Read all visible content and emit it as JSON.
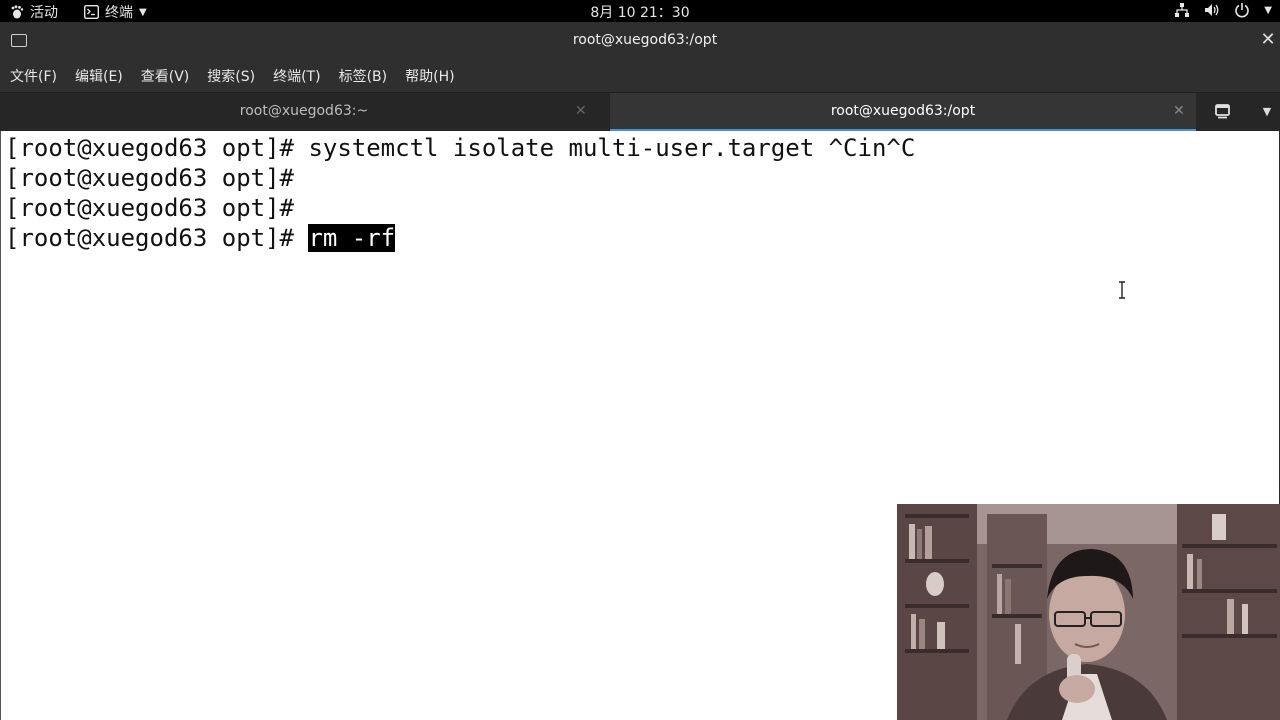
{
  "topbar": {
    "activities_label": "活动",
    "app_label": "终端",
    "clock": "8月 10  21：30"
  },
  "window": {
    "title": "root@xuegod63:/opt"
  },
  "menu": {
    "items": [
      "文件(F)",
      "编辑(E)",
      "查看(V)",
      "搜索(S)",
      "终端(T)",
      "标签(B)",
      "帮助(H)"
    ]
  },
  "tabs": [
    {
      "label": "root@xuegod63:~",
      "active": false
    },
    {
      "label": "root@xuegod63:/opt",
      "active": true
    }
  ],
  "terminal": {
    "lines": [
      {
        "prompt": "[root@xuegod63 opt]# ",
        "command": "systemctl isolate multi-user.target ^Cin^C",
        "selected": ""
      },
      {
        "prompt": "[root@xuegod63 opt]# ",
        "command": "",
        "selected": ""
      },
      {
        "prompt": "[root@xuegod63 opt]# ",
        "command": "",
        "selected": ""
      },
      {
        "prompt": "[root@xuegod63 opt]# ",
        "command": "",
        "selected": "rm -rf"
      }
    ]
  },
  "colors": {
    "topbar_bg": "#000000",
    "titlebar_bg": "#2f2f2f",
    "terminal_bg": "#ffffff",
    "selection_bg": "#000000"
  },
  "icons": {
    "activities": "gnome-foot-icon",
    "app": "terminal-icon",
    "tray": [
      "network-icon",
      "volume-icon",
      "power-icon"
    ]
  }
}
